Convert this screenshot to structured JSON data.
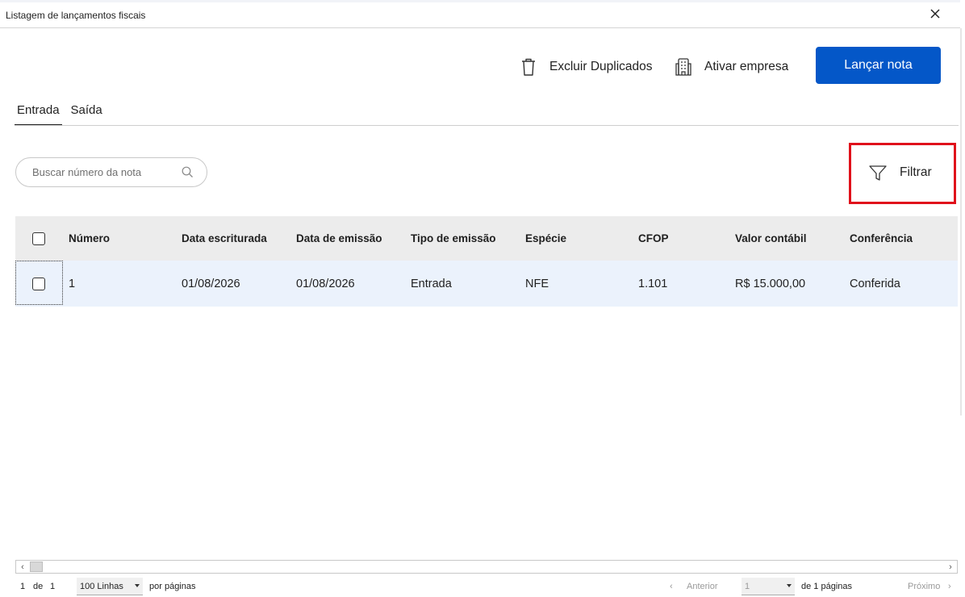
{
  "window": {
    "title": "Listagem de lançamentos fiscais",
    "close_icon": "close-icon"
  },
  "toolbar": {
    "excluir_label": "Excluir Duplicados",
    "excluir_icon": "trash-icon",
    "ativar_label": "Ativar empresa",
    "ativar_icon": "building-icon",
    "primary_label": "Lançar nota",
    "primary_color": "#0457c8"
  },
  "tabs": [
    {
      "label": "Entrada",
      "active": true
    },
    {
      "label": "Saída",
      "active": false
    }
  ],
  "search": {
    "placeholder": "Buscar número da nota",
    "icon": "search-icon"
  },
  "filter": {
    "label": "Filtrar",
    "icon": "filter-icon",
    "highlight_color": "#e0111b"
  },
  "table": {
    "columns": [
      "Número",
      "Data escriturada",
      "Data de emissão",
      "Tipo de emissão",
      "Espécie",
      "CFOP",
      "Valor contábil",
      "Conferência"
    ],
    "rows": [
      [
        "1",
        "01/08/2026",
        "01/08/2026",
        "Entrada",
        "NFE",
        "1.101",
        "R$ 15.000,00",
        "Conferida"
      ]
    ]
  },
  "pager": {
    "current": "1",
    "of_label": "de",
    "total": "1",
    "rows_select": "100 Linhas",
    "per_page_label": "por páginas",
    "prev_label": "Anterior",
    "page_select": "1",
    "pages_label": "de 1 páginas",
    "next_label": "Próximo"
  }
}
